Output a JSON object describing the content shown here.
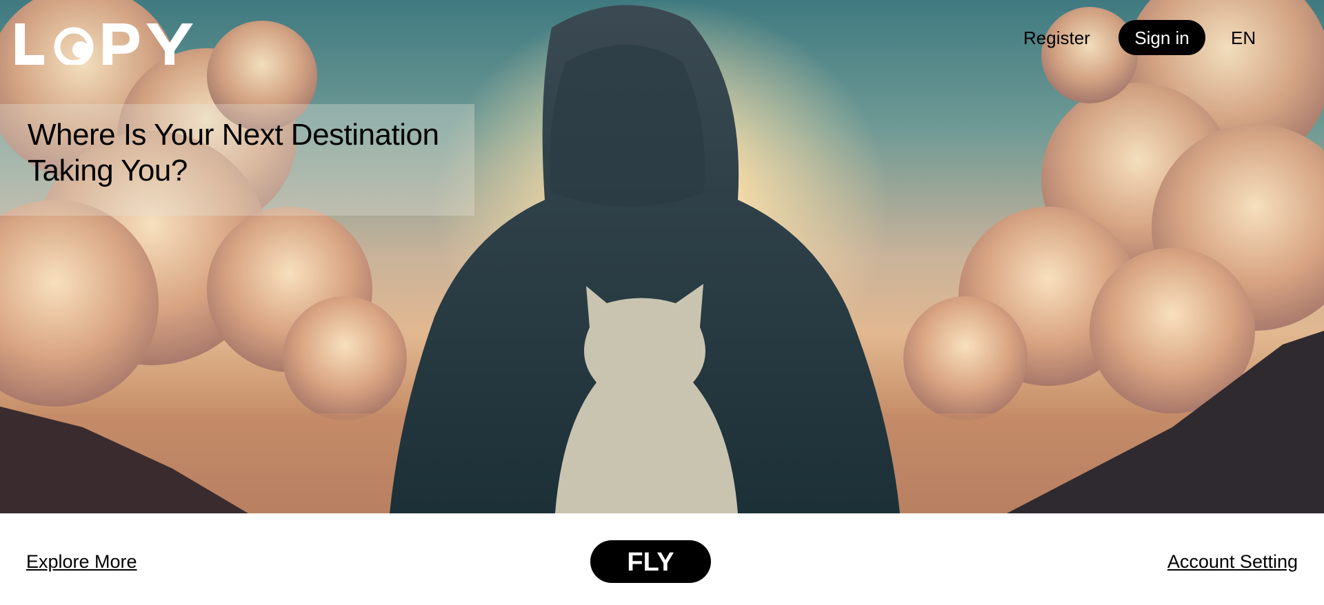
{
  "brand": {
    "logo_text": "LOPY"
  },
  "hero": {
    "headline": "Where Is Your Next Destination Taking You?"
  },
  "nav": {
    "register": "Register",
    "sign_in": "Sign in",
    "language": "EN"
  },
  "footer": {
    "explore": "Explore More",
    "fly": "FLY",
    "account": "Account Setting"
  },
  "colors": {
    "button_bg": "#000000",
    "button_text": "#ffffff"
  }
}
